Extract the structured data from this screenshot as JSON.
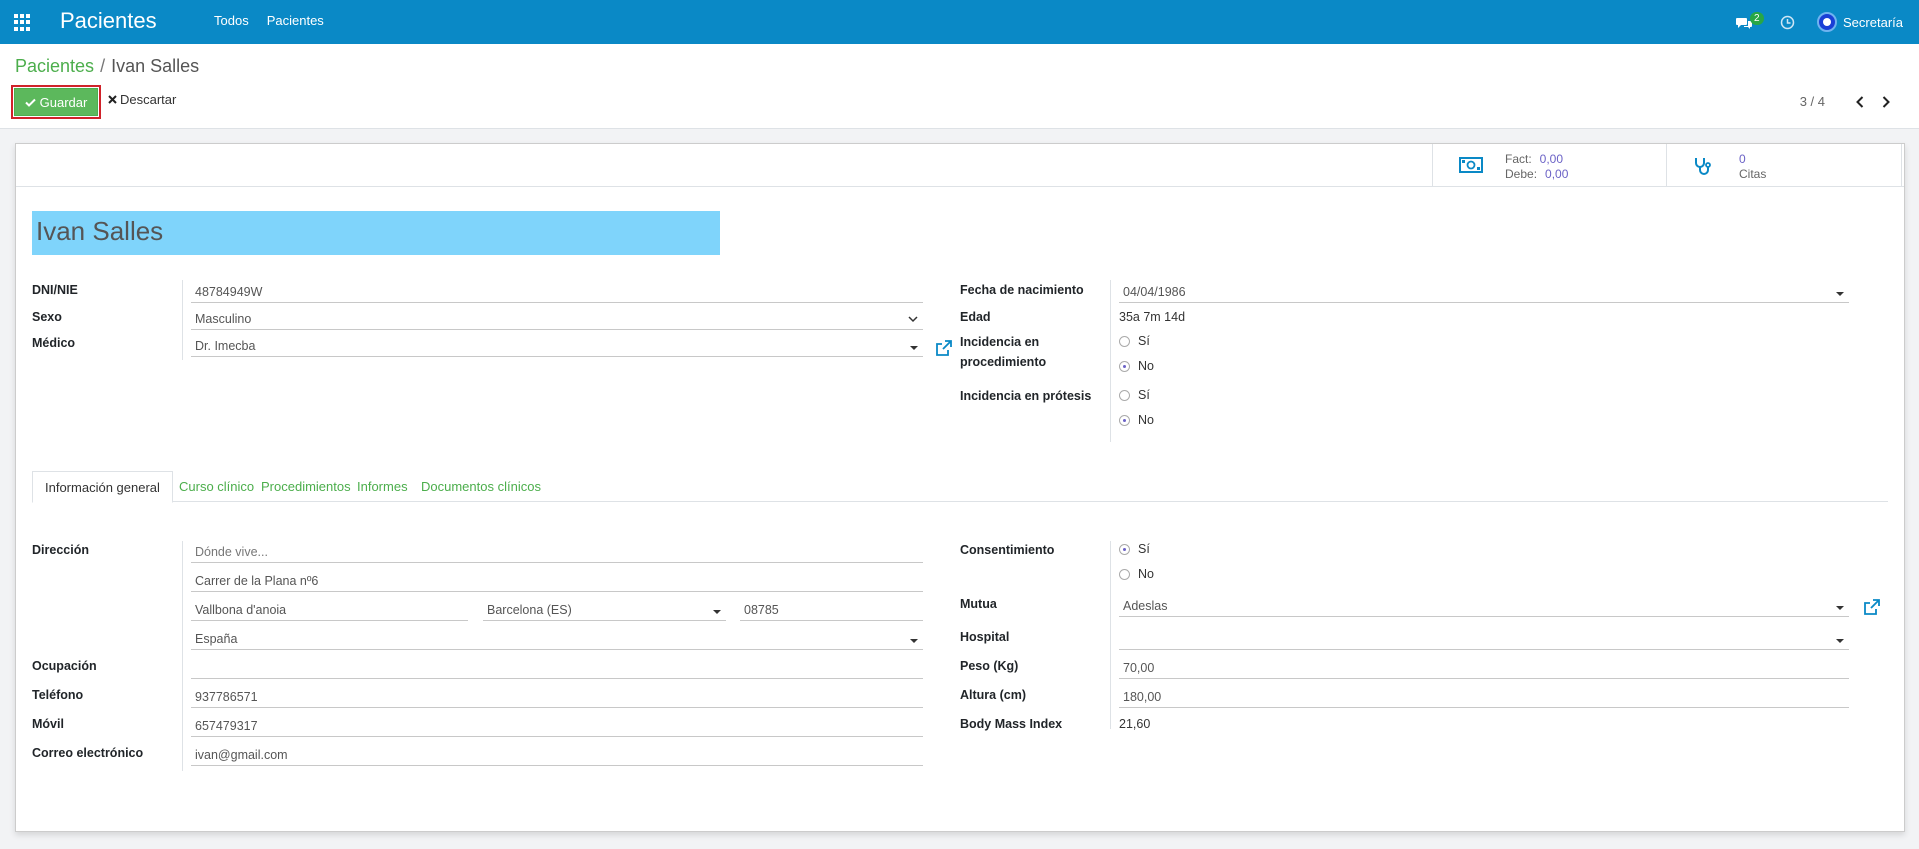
{
  "navbar": {
    "brand": "Pacientes",
    "menu": [
      "Todos",
      "Pacientes"
    ],
    "chat_count": "2",
    "user": "Secretaría",
    "color": "#0a89c6"
  },
  "breadcrumb": {
    "parent": "Pacientes",
    "separator": "/",
    "current": "Ivan Salles"
  },
  "toolbar": {
    "save_label": "Guardar",
    "discard_label": "Descartar"
  },
  "pager": {
    "value": "3 / 4"
  },
  "stats": {
    "fact_label": "Fact:",
    "fact_value": "0,00",
    "debe_label": "Debe:",
    "debe_value": "0,00",
    "citas_count": "0",
    "citas_label": "Citas"
  },
  "patient": {
    "name": "Ivan Salles"
  },
  "left_fields": {
    "dni_label": "DNI/NIE",
    "dni_value": "48784949W",
    "sexo_label": "Sexo",
    "sexo_value": "Masculino",
    "medico_label": "Médico",
    "medico_value": "Dr. Imecba"
  },
  "right_fields": {
    "nacimiento_label": "Fecha de nacimiento",
    "nacimiento_value": "04/04/1986",
    "edad_label": "Edad",
    "edad_value": "35a 7m 14d",
    "inc_proc_label_1": "Incidencia en",
    "inc_proc_label_2": "procedimiento",
    "inc_protesis_label": "Incidencia en prótesis",
    "yes": "Sí",
    "no": "No"
  },
  "tabs": [
    "Información general",
    "Curso clínico",
    "Procedimientos",
    "Informes",
    "Documentos clínicos"
  ],
  "general": {
    "direccion_label": "Dirección",
    "street_placeholder": "Dónde vive...",
    "street2": "Carrer de la Plana nº6",
    "city": "Vallbona d'anoia",
    "state": "Barcelona (ES)",
    "zip": "08785",
    "country": "España",
    "ocupacion_label": "Ocupación",
    "ocupacion_value": "",
    "telefono_label": "Teléfono",
    "telefono_value": "937786571",
    "movil_label": "Móvil",
    "movil_value": "657479317",
    "email_label": "Correo electrónico",
    "email_value": "ivan@gmail.com",
    "consentimiento_label": "Consentimiento",
    "yes": "Sí",
    "no": "No",
    "mutua_label": "Mutua",
    "mutua_value": "Adeslas",
    "hospital_label": "Hospital",
    "hospital_value": "",
    "peso_label": "Peso (Kg)",
    "peso_value": "70,00",
    "altura_label": "Altura (cm)",
    "altura_value": "180,00",
    "bmi_label": "Body Mass Index",
    "bmi_value": "21,60"
  }
}
